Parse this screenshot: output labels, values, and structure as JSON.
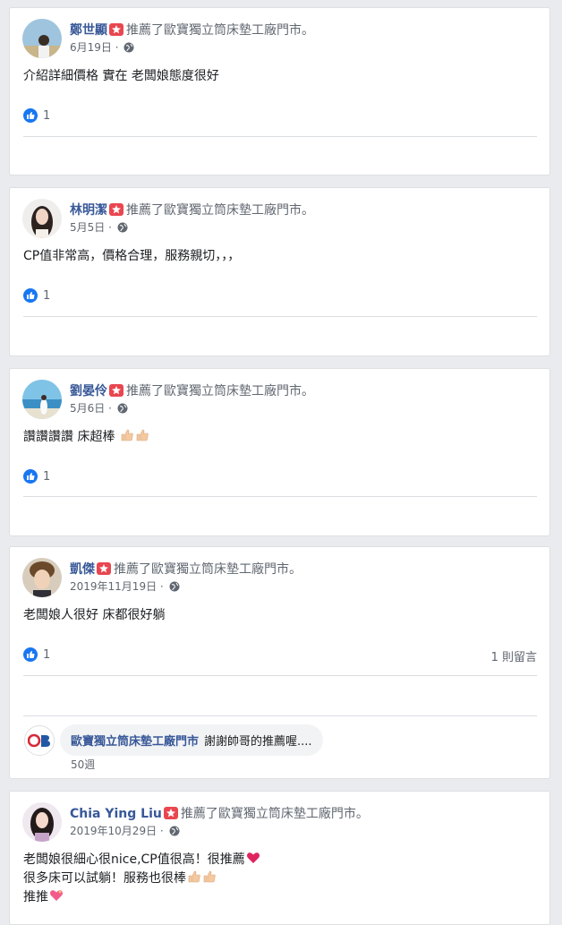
{
  "reviews": [
    {
      "name": "鄭世顯",
      "action": "推薦了歐寶獨立筒床墊工廠門市。",
      "date": "6月19日",
      "text": "介紹詳細價格 實在 老闆娘態度很好",
      "likes": "1",
      "avatar_icon": "person-sky-avatar-icon"
    },
    {
      "name": "林明潔",
      "action": "推薦了歐寶獨立筒床墊工廠門市。",
      "date": "5月5日",
      "text": "CP值非常高，價格合理，服務親切，，，",
      "likes": "1",
      "avatar_icon": "woman-avatar-icon"
    },
    {
      "name": "劉晏伶",
      "action": "推薦了歐寶獨立筒床墊工廠門市。",
      "date": "5月6日",
      "text": "讚讚讚讚 床超棒",
      "likes": "1",
      "avatar_icon": "beach-avatar-icon"
    },
    {
      "name": "凱傑",
      "action": "推薦了歐寶獨立筒床墊工廠門市。",
      "date": "2019年11月19日",
      "text": "老闆娘人很好 床都很好躺",
      "likes": "1",
      "comments": "1 則留言",
      "reply": {
        "author": "歐寶獨立筒床墊工廠門市",
        "text": "謝謝帥哥的推薦喔....",
        "time": "50週",
        "logo_text": "OB"
      },
      "avatar_icon": "man-avatar-icon"
    },
    {
      "name": "Chia Ying Liu",
      "action": "推薦了歐寶獨立筒床墊工廠門市。",
      "date": "2019年10月29日",
      "lines": [
        "老闆娘很細心很nice,CP值很高！很推薦",
        "很多床可以試躺！服務也很棒",
        "推推"
      ],
      "avatar_icon": "woman-avatar-icon"
    }
  ],
  "colors": {
    "background": "#e9ebee",
    "name_link": "#385898",
    "like_blue": "#1877f2",
    "recommend_red": "#e9464f"
  }
}
